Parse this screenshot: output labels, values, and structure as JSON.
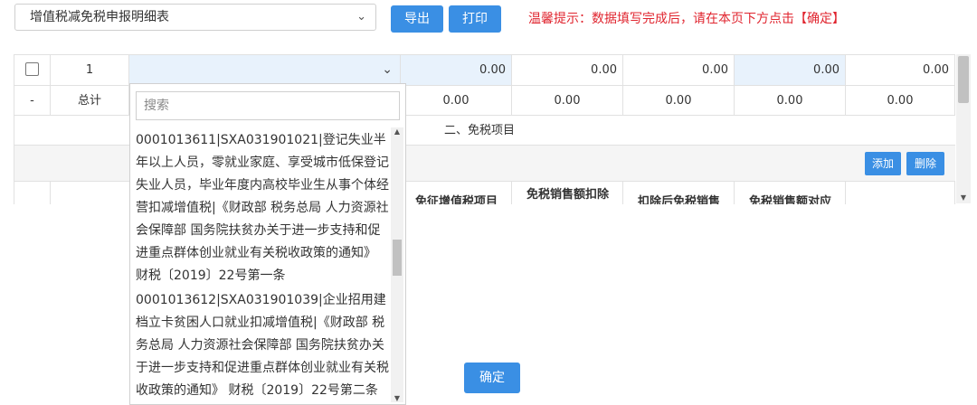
{
  "toolbar": {
    "report_select": "增值税减免税申报明细表",
    "export_label": "导出",
    "print_label": "打印",
    "tip": "温馨提示：数据填写完成后，请在本页下方点击【确定】"
  },
  "table": {
    "row1": {
      "index": "1",
      "values": [
        "0.00",
        "0.00",
        "0.00",
        "0.00",
        "0.00"
      ]
    },
    "total": {
      "marker": "-",
      "label": "总计",
      "values": [
        "0.00",
        "0.00",
        "0.00",
        "0.00",
        "0.00"
      ]
    },
    "section_title": "二、免税项目",
    "add_label": "添加",
    "delete_label": "删除",
    "headers": [
      "免征增值税项目",
      "免税销售额扣除",
      "扣除后免税销售",
      "免税销售额对应"
    ]
  },
  "dropdown": {
    "search_placeholder": "搜索",
    "options": [
      "0001013611|SXA031901021|登记失业半年以上人员，零就业家庭、享受城市低保登记失业人员，毕业年度内高校毕业生从事个体经营扣减增值税|《财政部 税务总局 人力资源社会保障部 国务院扶贫办关于进一步支持和促进重点群体创业就业有关税收政策的通知》 财税〔2019〕22号第一条",
      "0001013612|SXA031901039|企业招用建档立卡贫困人口就业扣减增值税|《财政部 税务总局 人力资源社会保障部 国务院扶贫办关于进一步支持和促进重点群体创业就业有关税收政策的通知》 财税〔2019〕22号第二条"
    ]
  },
  "footer": {
    "confirm_label": "确定"
  },
  "colors": {
    "accent": "#3a8fe4",
    "tip": "#e0252f",
    "highlight": "#e8f2fc"
  },
  "icons": {
    "select_chevron": "chevron-down-icon",
    "checkbox": "checkbox-icon"
  }
}
